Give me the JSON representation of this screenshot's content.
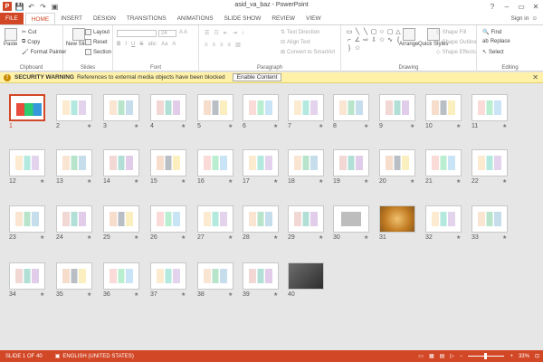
{
  "window": {
    "title": "asid_va_baz - PowerPoint",
    "app_icon": "P",
    "min": "–",
    "restore": "▭",
    "close": "✕",
    "help": "?"
  },
  "qat": {
    "save_icon": "save-icon",
    "undo_icon": "undo-icon",
    "redo_icon": "redo-icon",
    "present_icon": "present-icon"
  },
  "tabs": [
    "FILE",
    "HOME",
    "INSERT",
    "DESIGN",
    "TRANSITIONS",
    "ANIMATIONS",
    "SLIDE SHOW",
    "REVIEW",
    "VIEW"
  ],
  "active_tab": "HOME",
  "signin": "Sign in",
  "ribbon": {
    "clipboard": {
      "label": "Clipboard",
      "paste": "Paste",
      "cut": "Cut",
      "copy": "Copy",
      "format_painter": "Format Painter"
    },
    "slides": {
      "label": "Slides",
      "new_slide": "New Slide",
      "layout": "Layout",
      "reset": "Reset",
      "section": "Section"
    },
    "font": {
      "label": "Font",
      "size": "24",
      "bold": "B",
      "italic": "I",
      "underline": "U",
      "strike": "S",
      "abc": "abc",
      "aa": "Aa",
      "a": "A"
    },
    "paragraph": {
      "label": "Paragraph",
      "text_direction": "Text Direction",
      "align_text": "Align Text",
      "convert_smartart": "Convert to SmartArt"
    },
    "drawing": {
      "label": "Drawing",
      "arrange": "Arrange",
      "quick_styles": "Quick Styles",
      "shape_fill": "Shape Fill",
      "shape_outline": "Shape Outline",
      "shape_effects": "Shape Effects"
    },
    "editing": {
      "label": "Editing",
      "find": "Find",
      "replace": "Replace",
      "select": "Select"
    }
  },
  "security": {
    "title": "SECURITY WARNING",
    "message": "References to external media objects have been blocked",
    "button": "Enable Content",
    "close": "✕"
  },
  "slides": [
    {
      "n": "1",
      "star": false
    },
    {
      "n": "2",
      "star": true
    },
    {
      "n": "3",
      "star": true
    },
    {
      "n": "4",
      "star": true
    },
    {
      "n": "5",
      "star": true
    },
    {
      "n": "6",
      "star": true
    },
    {
      "n": "7",
      "star": true
    },
    {
      "n": "8",
      "star": true
    },
    {
      "n": "9",
      "star": true
    },
    {
      "n": "10",
      "star": true
    },
    {
      "n": "11",
      "star": true
    },
    {
      "n": "12",
      "star": true
    },
    {
      "n": "13",
      "star": true
    },
    {
      "n": "14",
      "star": true
    },
    {
      "n": "15",
      "star": true
    },
    {
      "n": "16",
      "star": true
    },
    {
      "n": "17",
      "star": true
    },
    {
      "n": "18",
      "star": true
    },
    {
      "n": "19",
      "star": true
    },
    {
      "n": "20",
      "star": true
    },
    {
      "n": "21",
      "star": true
    },
    {
      "n": "22",
      "star": true
    },
    {
      "n": "23",
      "star": true
    },
    {
      "n": "24",
      "star": true
    },
    {
      "n": "25",
      "star": true
    },
    {
      "n": "26",
      "star": true
    },
    {
      "n": "27",
      "star": true
    },
    {
      "n": "28",
      "star": true
    },
    {
      "n": "29",
      "star": true
    },
    {
      "n": "30",
      "star": true
    },
    {
      "n": "31",
      "star": false
    },
    {
      "n": "32",
      "star": true
    },
    {
      "n": "33",
      "star": true
    },
    {
      "n": "34",
      "star": true
    },
    {
      "n": "35",
      "star": true
    },
    {
      "n": "36",
      "star": true
    },
    {
      "n": "37",
      "star": true
    },
    {
      "n": "38",
      "star": true
    },
    {
      "n": "39",
      "star": true
    },
    {
      "n": "40",
      "star": false
    }
  ],
  "status": {
    "slide_info": "SLIDE 1 OF 40",
    "language": "ENGLISH (UNITED STATES)",
    "zoom": "33%"
  },
  "colors": {
    "accent": "#d24726",
    "warning_bg": "#fff2a8"
  }
}
